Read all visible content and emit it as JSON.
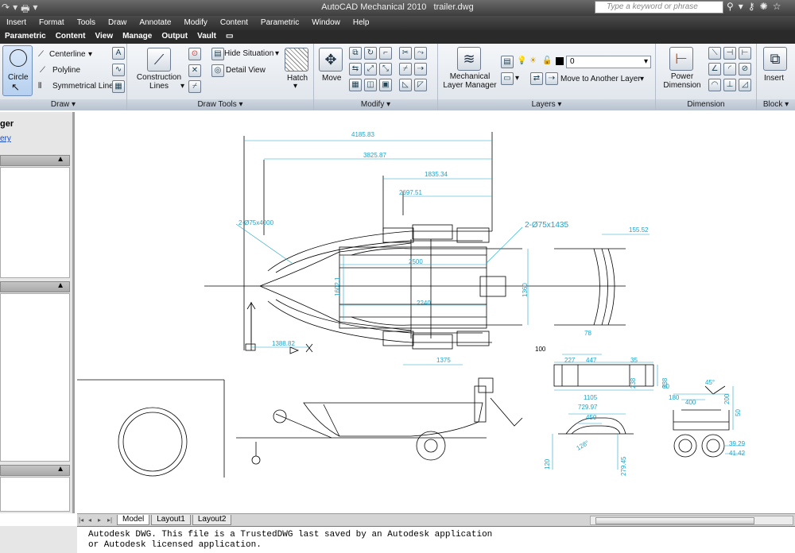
{
  "app": {
    "title": "AutoCAD Mechanical 2010",
    "file": "trailer.dwg",
    "search_placeholder": "Type a keyword or phrase"
  },
  "menu": [
    "Insert",
    "Format",
    "Tools",
    "Draw",
    "Annotate",
    "Modify",
    "Content",
    "Parametric",
    "Window",
    "Help"
  ],
  "ribbon_tabs": [
    "Parametric",
    "Content",
    "View",
    "Manage",
    "Output",
    "Vault"
  ],
  "ribbon": {
    "draw": {
      "circle": "Circle",
      "centerline": "Centerline",
      "polyline": "Polyline",
      "symmetrical_line": "Symmetrical Line",
      "panel": "Draw"
    },
    "draw_tools": {
      "construction_lines": "Construction Lines",
      "hide_situation": "Hide Situation",
      "detail_view": "Detail View",
      "hatch": "Hatch",
      "panel": "Draw Tools"
    },
    "modify": {
      "move": "Move",
      "panel": "Modify"
    },
    "layers": {
      "layer_manager": "Mechanical Layer Manager",
      "current_layer": "0",
      "move_to_layer": "Move to Another Layer",
      "panel": "Layers"
    },
    "dimension": {
      "power_dimension": "Power Dimension",
      "panel": "Dimension"
    },
    "block": {
      "insert": "Insert",
      "panel": "Block"
    }
  },
  "palette": {
    "title": "ger",
    "link": "ery"
  },
  "drawing": {
    "dims": {
      "d4185": "4185.83",
      "d3825": "3825.87",
      "d1835": "1835.34",
      "d2697": "2697.51",
      "d2500": "2500",
      "d2240": "2240",
      "d1375": "1375",
      "d1388": "1388.82",
      "d1360": "1360",
      "d1602": "1602.1",
      "d155": "155.52",
      "d78": "78",
      "tube1": "2-Ø75x4000",
      "tube2": "2-Ø75x1435",
      "d100": "100",
      "d227": "227",
      "d447": "447",
      "d35": "35",
      "d1105": "1105",
      "d238": "238",
      "d338": "338",
      "d729": "729.97",
      "d450": "450",
      "d128": "128°",
      "d120": "120",
      "d279": "279.45",
      "d60": "60",
      "d180": "180",
      "d400": "400",
      "d45": "45°",
      "d200": "200",
      "d50": "50",
      "d39": "39.29",
      "d41": "41.42"
    }
  },
  "layout_tabs": [
    "Model",
    "Layout1",
    "Layout2"
  ],
  "command": {
    "line1": "Autodesk DWG.  This file is a TrustedDWG last saved by an Autodesk application",
    "line2": "or Autodesk licensed application."
  },
  "colors": {
    "dim": "#1fa3c8",
    "geometry": "#000000",
    "ribbon": "#dde3ea"
  }
}
